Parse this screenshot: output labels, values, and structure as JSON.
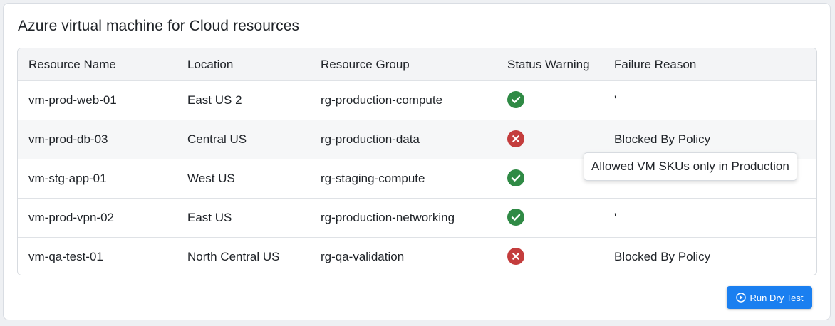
{
  "title": "Azure virtual machine for Cloud resources",
  "table": {
    "headers": [
      "Resource Name",
      "Location",
      "Resource Group",
      "Status Warning",
      "Failure Reason"
    ],
    "rows": [
      {
        "name": "vm-prod-web-01",
        "location": "East US 2",
        "group": "rg-production-compute",
        "status": "ok",
        "reason": "'"
      },
      {
        "name": "vm-prod-db-03",
        "location": "Central US",
        "group": "rg-production-data",
        "status": "error",
        "reason": "Blocked By Policy"
      },
      {
        "name": "vm-stg-app-01",
        "location": "West US",
        "group": "rg-staging-compute",
        "status": "ok",
        "reason": ""
      },
      {
        "name": "vm-prod-vpn-02",
        "location": "East US",
        "group": "rg-production-networking",
        "status": "ok",
        "reason": "'"
      },
      {
        "name": "vm-qa-test-01",
        "location": "North Central US",
        "group": "rg-qa-validation",
        "status": "error",
        "reason": "Blocked By Policy"
      }
    ]
  },
  "status_icons": {
    "ok": "check-circle-icon",
    "error": "x-circle-icon"
  },
  "tooltip": "Allowed VM SKUs only in Production",
  "button": {
    "label": "Run Dry Test",
    "icon": "play-circle-icon"
  },
  "colors": {
    "ok": "#2f8a45",
    "error": "#c43d3d",
    "primary": "#1a7ff0"
  }
}
